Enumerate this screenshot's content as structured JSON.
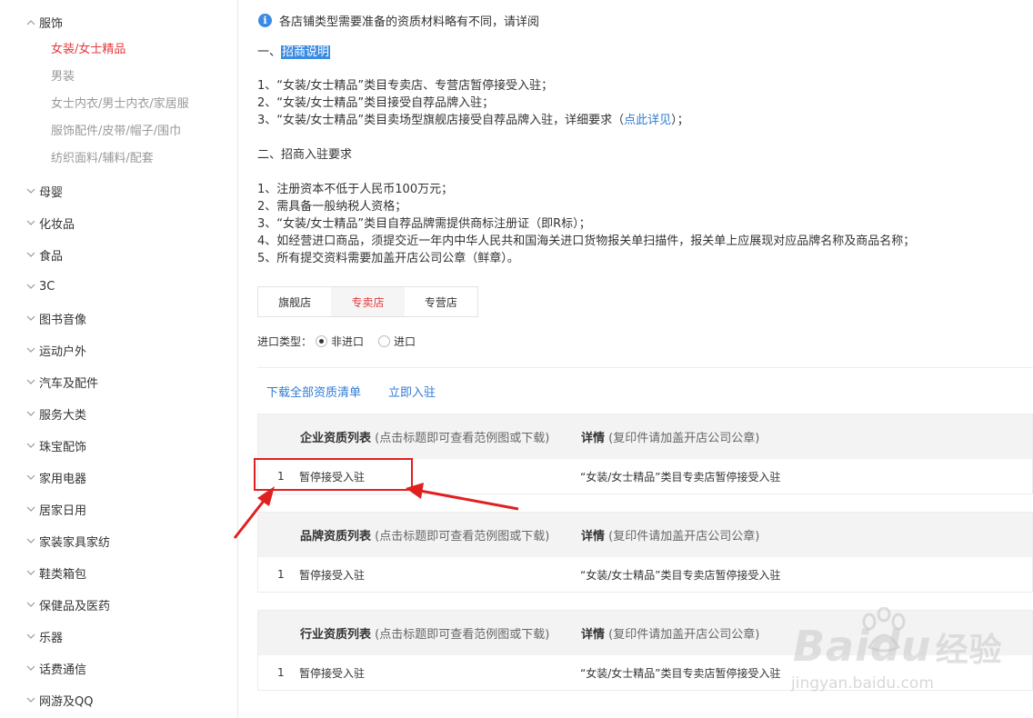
{
  "sidebar": {
    "categories": [
      {
        "label": "服饰",
        "expanded": true,
        "subs": [
          "女装/女士精品",
          "男装",
          "女士内衣/男士内衣/家居服",
          "服饰配件/皮带/帽子/围巾",
          "纺织面料/辅料/配套"
        ],
        "active_sub": 0
      },
      {
        "label": "母婴"
      },
      {
        "label": "化妆品"
      },
      {
        "label": "食品"
      },
      {
        "label": "3C"
      },
      {
        "label": "图书音像"
      },
      {
        "label": "运动户外"
      },
      {
        "label": "汽车及配件"
      },
      {
        "label": "服务大类"
      },
      {
        "label": "珠宝配饰"
      },
      {
        "label": "家用电器"
      },
      {
        "label": "居家日用"
      },
      {
        "label": "家装家具家纺"
      },
      {
        "label": "鞋类箱包"
      },
      {
        "label": "保健品及医药"
      },
      {
        "label": "乐器"
      },
      {
        "label": "话费通信"
      },
      {
        "label": "网游及QQ"
      }
    ]
  },
  "notice": {
    "icon": "info-icon",
    "text": "各店铺类型需要准备的资质材料略有不同，请详阅"
  },
  "section1": {
    "prefix": "一、",
    "title": "招商说明",
    "items": [
      "1、“女装/女士精品”类目专卖店、专营店暂停接受入驻；",
      "2、“女装/女士精品”类目接受自荐品牌入驻；"
    ],
    "item3_pre": "3、“女装/女士精品”类目卖场型旗舰店接受自荐品牌入驻，详细要求（",
    "item3_link": "点此详见",
    "item3_post": "）；"
  },
  "section2": {
    "title": "二、招商入驻要求",
    "items": [
      "1、注册资本不低于人民币100万元；",
      "2、需具备一般纳税人资格；",
      "3、“女装/女士精品”类目自荐品牌需提供商标注册证（即R标）；",
      "4、如经营进口商品，须提交近一年内中华人民共和国海关进口货物报关单扫描件，报关单上应展现对应品牌名称及商品名称；",
      "5、所有提交资料需要加盖开店公司公章（鲜章）。"
    ]
  },
  "tabs": {
    "items": [
      "旗舰店",
      "专卖店",
      "专营店"
    ],
    "active": 1
  },
  "import": {
    "label": "进口类型：",
    "options": [
      "非进口",
      "进口"
    ],
    "selected": 0
  },
  "actions": {
    "download": "下载全部资质清单",
    "apply": "立即入驻"
  },
  "tables": [
    {
      "title": "企业资质列表",
      "hint": "(点击标题即可查看范例图或下载)",
      "detail_title": "详情",
      "detail_hint": "(复印件请加盖开店公司公章)",
      "rows": [
        {
          "num": "1",
          "name": "暂停接受入驻",
          "detail": "“女装/女士精品”类目专卖店暂停接受入驻"
        }
      ]
    },
    {
      "title": "品牌资质列表",
      "hint": "(点击标题即可查看范例图或下载)",
      "detail_title": "详情",
      "detail_hint": "(复印件请加盖开店公司公章)",
      "rows": [
        {
          "num": "1",
          "name": "暂停接受入驻",
          "detail": "“女装/女士精品”类目专卖店暂停接受入驻"
        }
      ]
    },
    {
      "title": "行业资质列表",
      "hint": "(点击标题即可查看范例图或下载)",
      "detail_title": "详情",
      "detail_hint": "(复印件请加盖开店公司公章)",
      "rows": [
        {
          "num": "1",
          "name": "暂停接受入驻",
          "detail": "“女装/女士精品”类目专卖店暂停接受入驻"
        }
      ]
    }
  ],
  "watermark": {
    "main": "Bai",
    "main2": "du",
    "cn": "经验",
    "url": "jingyan.baidu.com"
  },
  "colors": {
    "accent_red": "#e4393c",
    "link_blue": "#2f7bd6",
    "annotation_red": "#e02020"
  }
}
